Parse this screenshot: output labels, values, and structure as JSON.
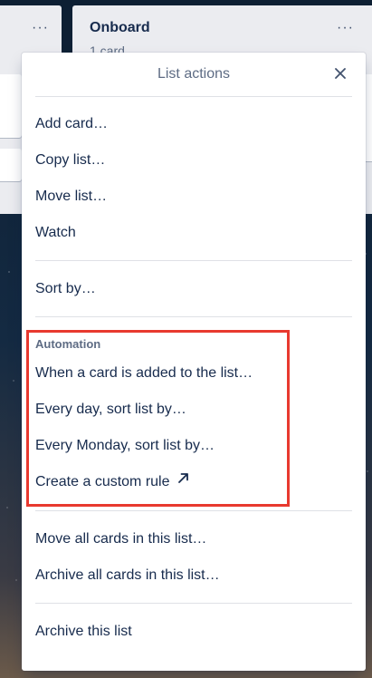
{
  "board": {
    "right_list": {
      "title": "Onboard",
      "subtitle": "1 card"
    },
    "more_icon_glyph": "···"
  },
  "popover": {
    "title": "List actions",
    "close_icon": "close-icon",
    "groups": [
      [
        "Add card…",
        "Copy list…",
        "Move list…",
        "Watch"
      ],
      [
        "Sort by…"
      ]
    ],
    "automation": {
      "label": "Automation",
      "items": [
        "When a card is added to the list…",
        "Every day, sort list by…",
        "Every Monday, sort list by…",
        "Create a custom rule"
      ],
      "external_icon": "arrow-up-right-icon"
    },
    "bulk_actions": [
      "Move all cards in this list…",
      "Archive all cards in this list…"
    ],
    "archive": "Archive this list"
  },
  "colors": {
    "highlight": "#e8392f",
    "text": "#172b4d",
    "muted": "#5e6c84"
  }
}
